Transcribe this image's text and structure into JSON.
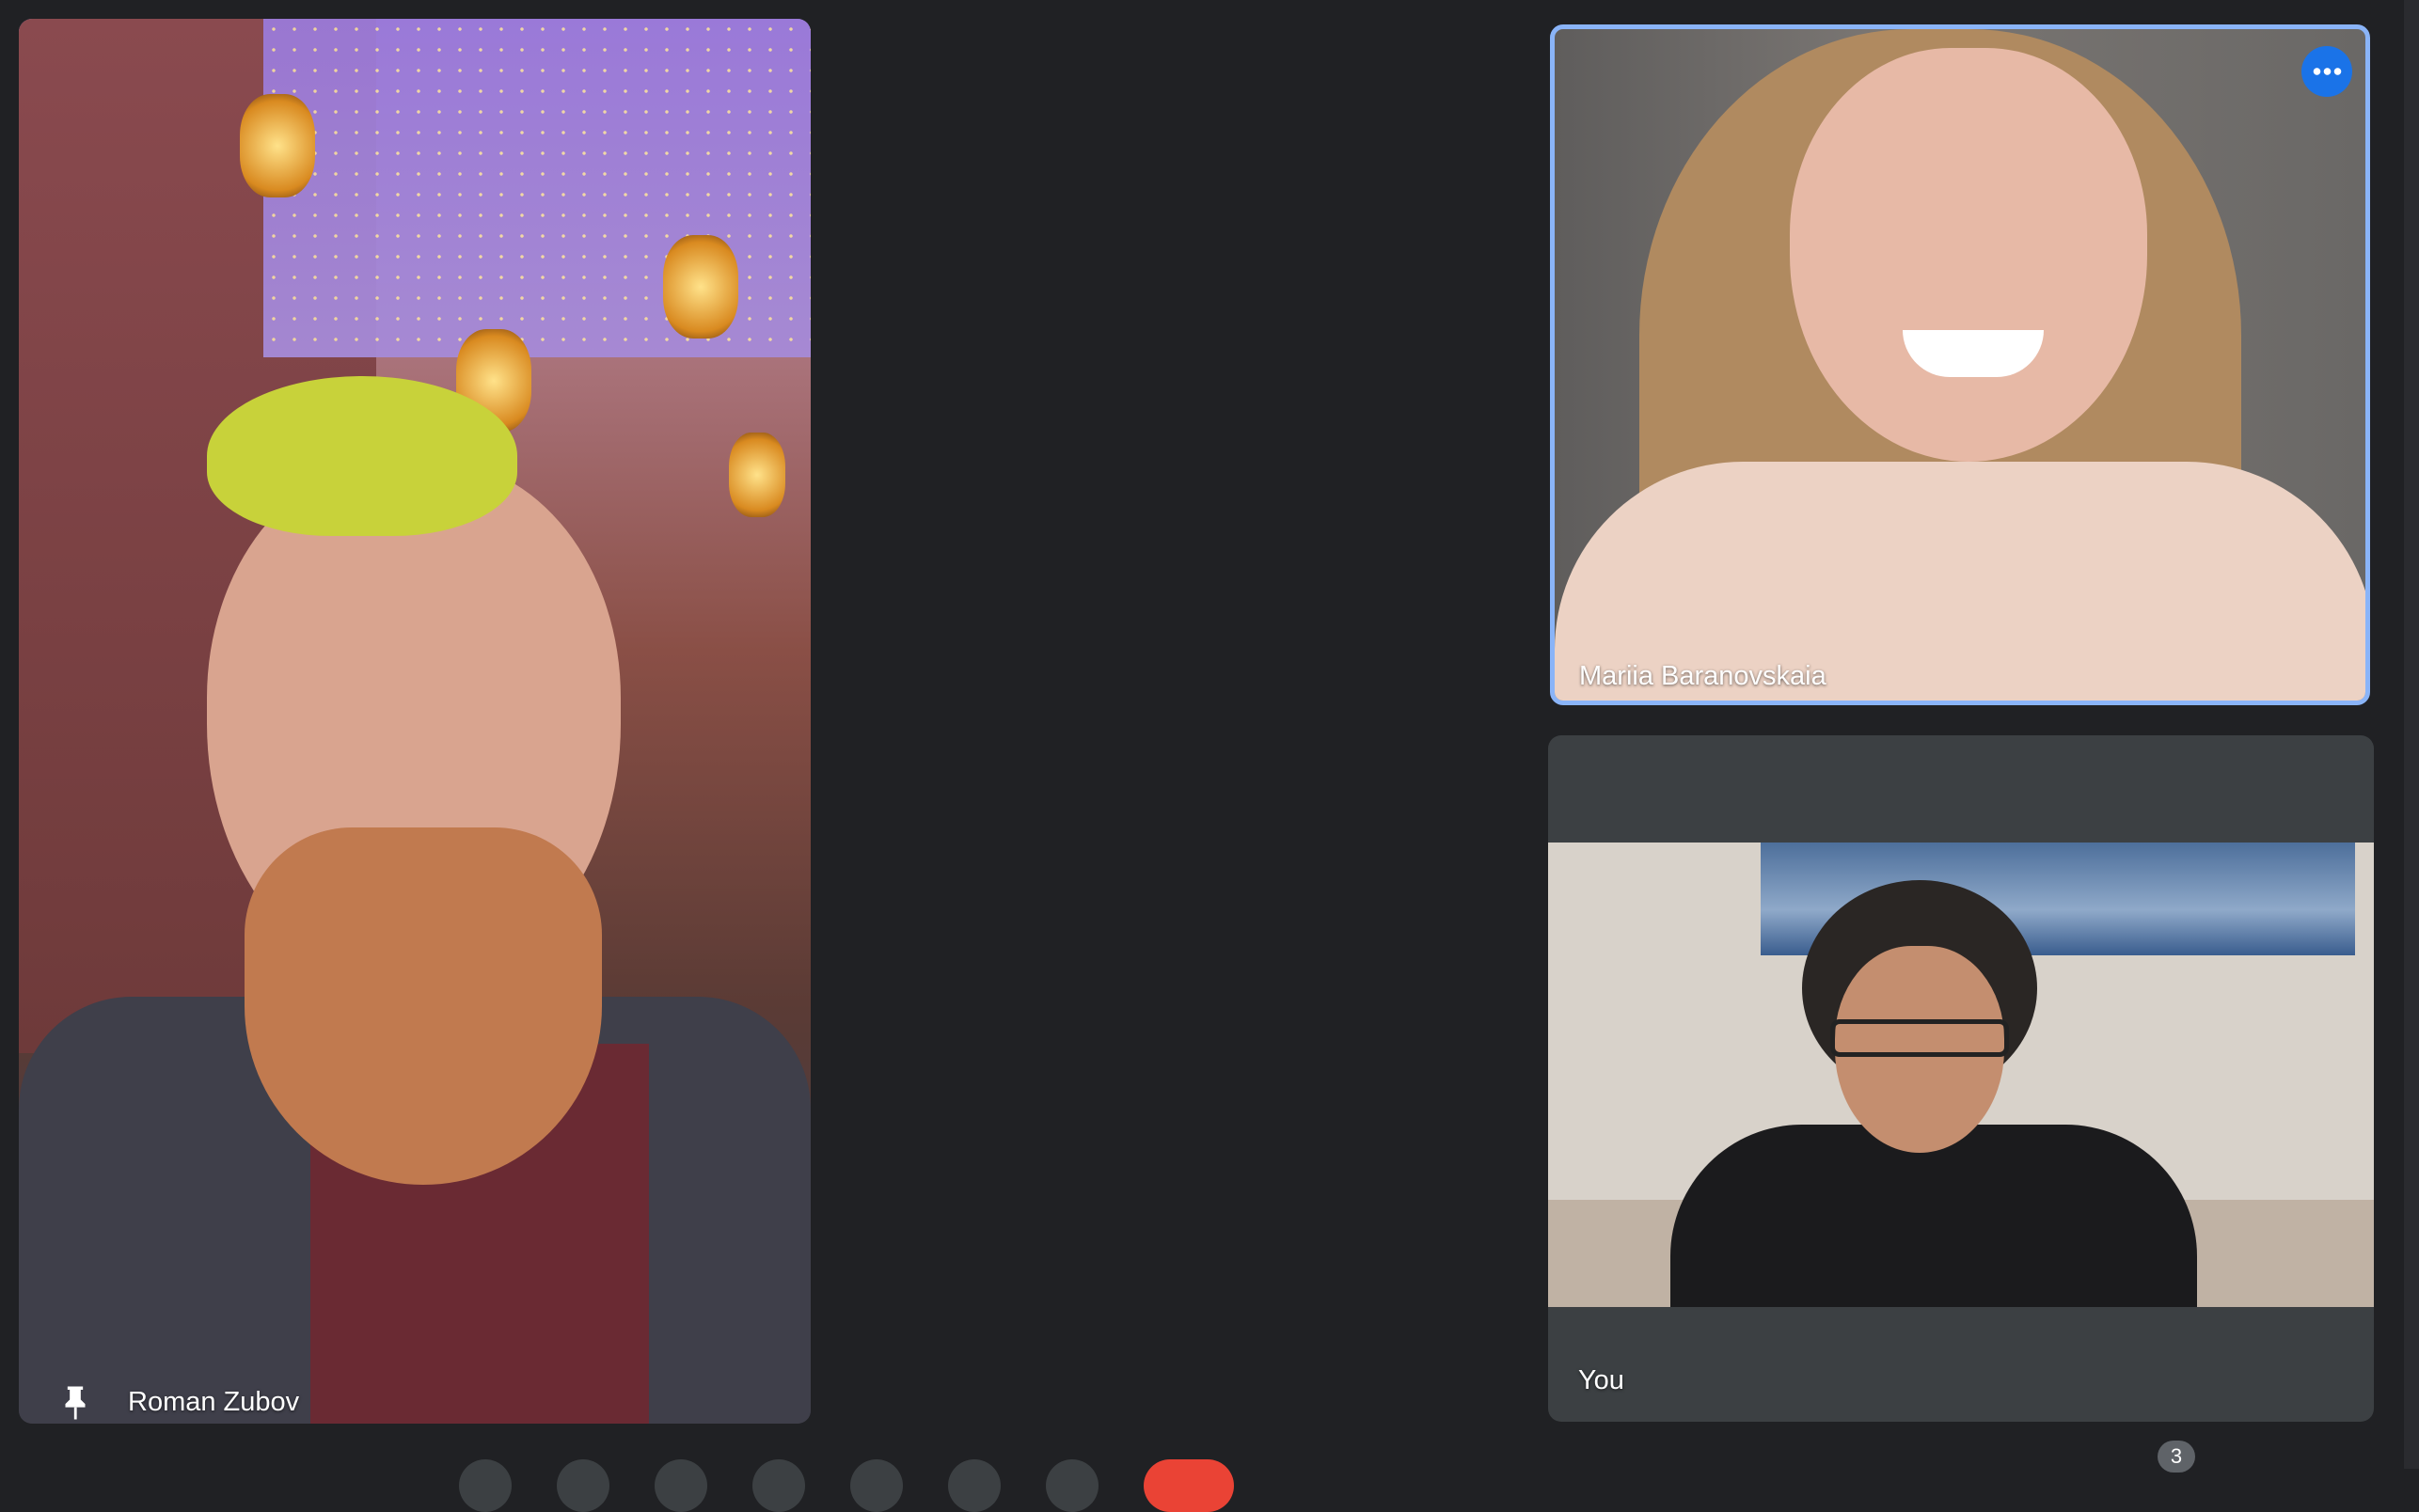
{
  "participants": [
    {
      "name": "Roman Zubov",
      "pinned": true
    },
    {
      "name": "Mariia Baranovskaia",
      "active_speaker": true
    },
    {
      "name": "You"
    }
  ],
  "participants_badge": "3",
  "colors": {
    "background": "#202124",
    "active_speaker_border": "#8ab4f8",
    "more_button": "#1a73e8",
    "end_call": "#ea4335",
    "self_tile": "#3c4043"
  },
  "icons": {
    "pin": "pin-icon",
    "more_options": "more-horiz-icon"
  }
}
